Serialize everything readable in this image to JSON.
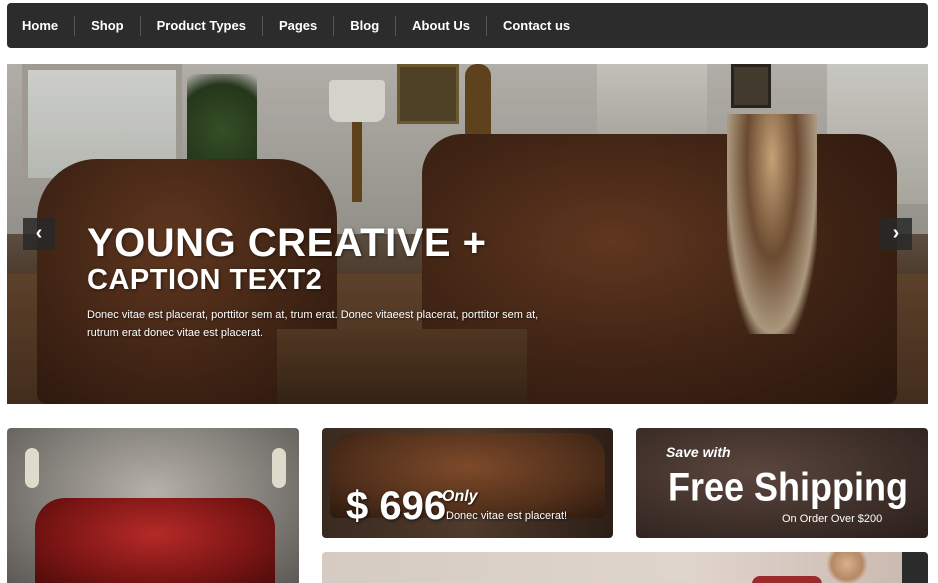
{
  "nav": {
    "items": [
      {
        "label": "Home"
      },
      {
        "label": "Shop"
      },
      {
        "label": "Product Types"
      },
      {
        "label": "Pages"
      },
      {
        "label": "Blog"
      },
      {
        "label": "About Us"
      },
      {
        "label": "Contact us"
      }
    ]
  },
  "slider": {
    "caption_title": "YOUNG CREATIVE +",
    "caption_subtitle": "CAPTION TEXT2",
    "caption_text": "Donec vitae est placerat, porttitor sem at, trum erat. Donec vitaeest placerat, porttitor sem at, rutrum erat donec vitae est placerat.",
    "prev_icon": "chevron-left-icon",
    "next_icon": "chevron-right-icon",
    "prev_glyph": "‹",
    "next_glyph": "›"
  },
  "banners": {
    "price_banner": {
      "price": "$ 696",
      "only_label": "Only",
      "description": "Donec vitae est placerat!"
    },
    "shipping_banner": {
      "save_label": "Save with",
      "headline": "Free Shipping",
      "condition": "On Order Over $200"
    }
  },
  "colors": {
    "nav_background": "#2c2c2c",
    "nav_text": "#ffffff",
    "accent_leather": "#4a2a18"
  }
}
